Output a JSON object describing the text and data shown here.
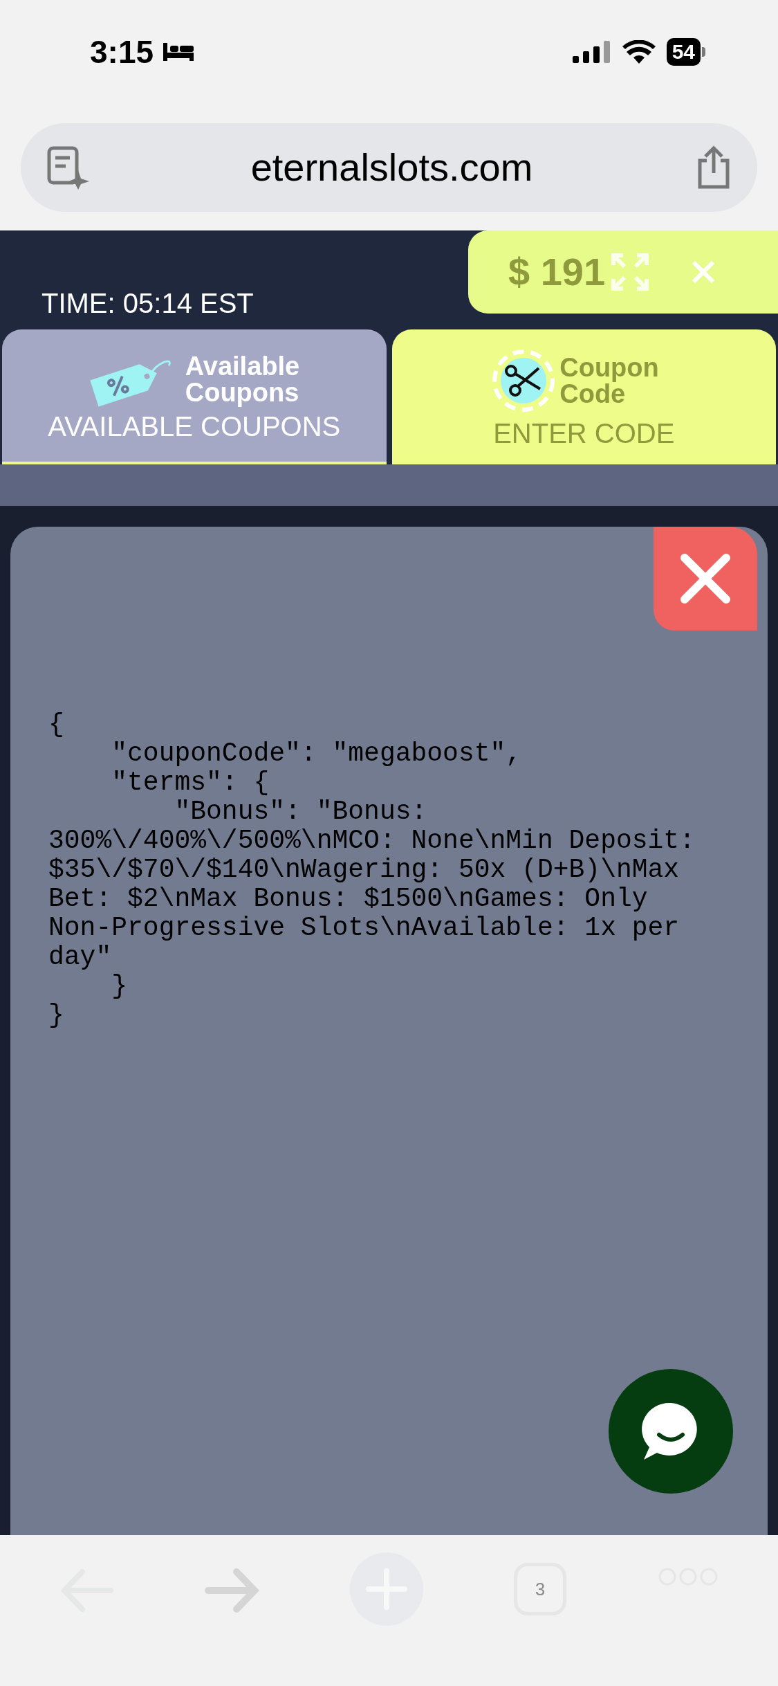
{
  "status_bar": {
    "time": "3:15",
    "battery": "54"
  },
  "browser": {
    "url": "eternalslots.com"
  },
  "header": {
    "time_label": "TIME: 05:14 EST",
    "balance": "$ 191"
  },
  "tabs": [
    {
      "kind": "tag",
      "title": "Available Coupons",
      "caption": "AVAILABLE COUPONS",
      "selected": true
    },
    {
      "kind": "scissors",
      "title": "Coupon Code",
      "caption": "ENTER CODE",
      "selected": false
    }
  ],
  "modal": {
    "code_lines": [
      "{",
      "    \"couponCode\": \"megaboost\",",
      "    \"terms\": {",
      "        \"Bonus\": \"Bonus:",
      "300%\\/400%\\/500%\\nMCO: None\\nMin Deposit:",
      "$35\\/$70\\/$140\\nWagering: 50x (D+B)\\nMax",
      "Bet: $2\\nMax Bonus: $1500\\nGames: Only",
      "Non-Progressive Slots\\nAvailable: 1x per",
      "day\"",
      "    }",
      "}"
    ]
  },
  "toolbar": {
    "tab_count": "3"
  }
}
